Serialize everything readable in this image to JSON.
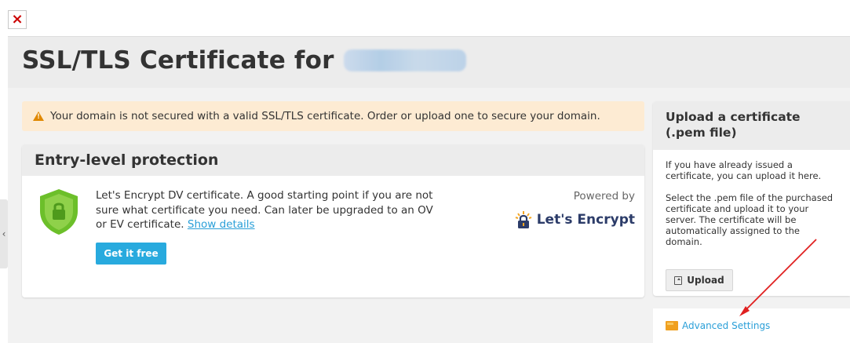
{
  "broken_image": {
    "glyph": "×"
  },
  "page": {
    "title": "SSL/TLS Certificate for",
    "left_tab_glyph": "‹"
  },
  "warning": {
    "text": "Your domain is not secured with a valid SSL/TLS certificate. Order or upload one to secure your domain.",
    "icon": "warning-triangle-icon",
    "bg_color": "#fdebd3",
    "icon_color": "#e08800"
  },
  "entry_card": {
    "title": "Entry-level protection",
    "description": "Let's Encrypt DV certificate. A good starting point if you are not sure what certificate you need. Can later be upgraded to an OV or EV certificate.",
    "show_details_link": "Show details",
    "get_button": "Get it free",
    "powered_by": "Powered by",
    "provider_logo_text": "Let's Encrypt",
    "shield_icon": "shield-lock-icon",
    "shield_color": "#6cbf2a",
    "button_color": "#28aade"
  },
  "upload_panel": {
    "title": "Upload a certificate (.pem file)",
    "para1": "If you have already issued a certificate, you can upload it here.",
    "para2": "Select the .pem file of the purchased certificate and upload it to your server. The certificate will be automatically assigned to the domain.",
    "upload_button": "Upload",
    "upload_icon": "upload-icon"
  },
  "advanced": {
    "label": "Advanced Settings",
    "icon": "settings-box-icon",
    "link_color": "#2a9fd8"
  },
  "annotation": {
    "arrow_color": "#e02020"
  }
}
